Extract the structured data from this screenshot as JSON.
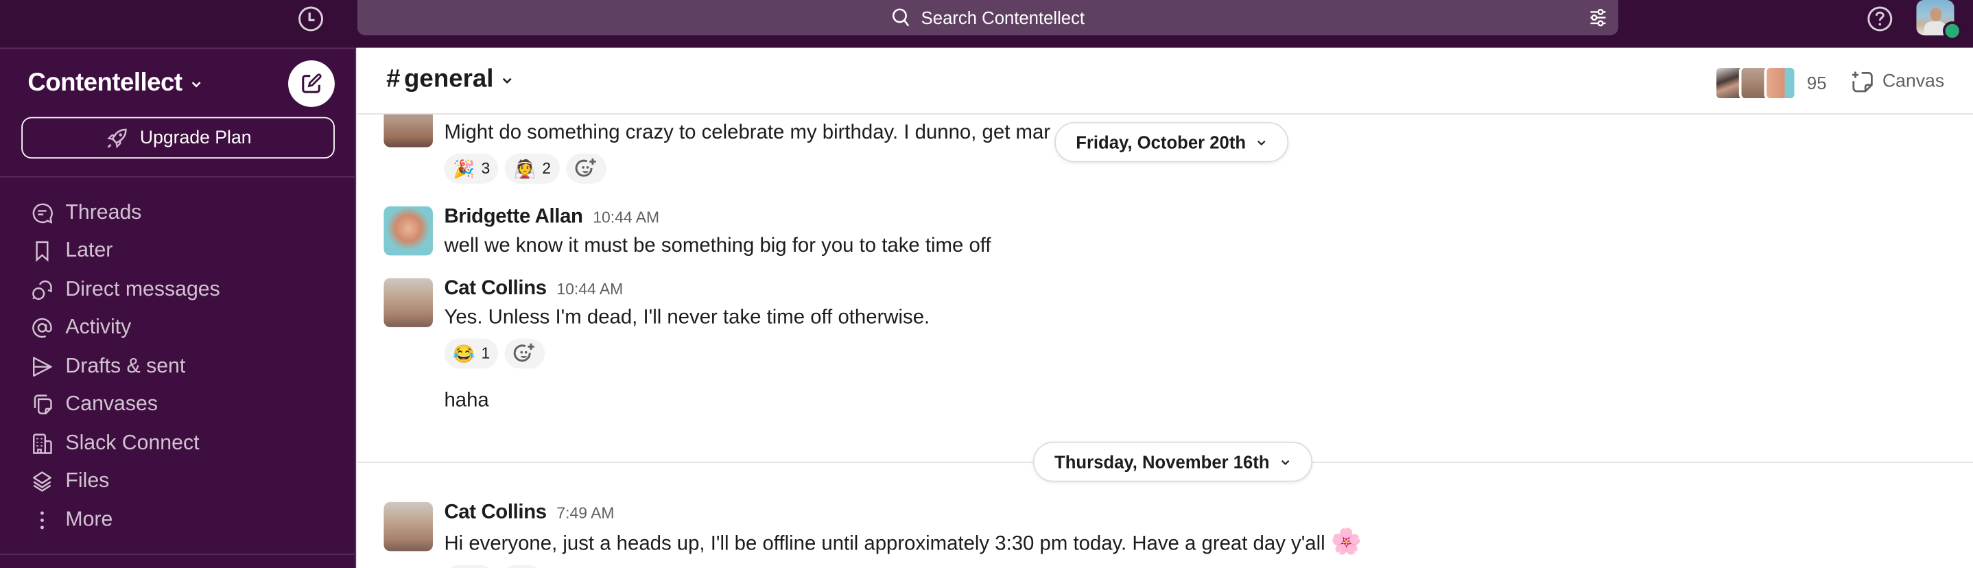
{
  "topbar": {
    "search_placeholder": "Search Contentellect",
    "icons": {
      "history": "clock-icon",
      "search": "search-icon",
      "filter": "sliders-icon",
      "help": "help-icon"
    },
    "user_presence": "active"
  },
  "sidebar": {
    "workspace_name": "Contentellect",
    "upgrade_label": "Upgrade Plan",
    "items": [
      {
        "label": "Threads",
        "icon": "threads-icon"
      },
      {
        "label": "Later",
        "icon": "bookmark-icon"
      },
      {
        "label": "Direct messages",
        "icon": "direct-messages-icon"
      },
      {
        "label": "Activity",
        "icon": "at-sign-icon"
      },
      {
        "label": "Drafts & sent",
        "icon": "send-icon"
      },
      {
        "label": "Canvases",
        "icon": "canvases-icon"
      },
      {
        "label": "Slack Connect",
        "icon": "building-icon"
      },
      {
        "label": "Files",
        "icon": "layers-icon"
      },
      {
        "label": "More",
        "icon": "more-vertical-icon"
      }
    ]
  },
  "channel": {
    "prefix": "#",
    "name": "general",
    "member_count": "95",
    "canvas_label": "Canvas"
  },
  "date_dividers": [
    {
      "label": "Friday, October 20th"
    },
    {
      "label": "Thursday, November 16th"
    }
  ],
  "messages": [
    {
      "author": "",
      "time": "",
      "text": "Might do something crazy to celebrate my birthday. I dunno, get mar",
      "reactions": [
        {
          "emoji": "🎉",
          "count": "3"
        },
        {
          "emoji": "👰",
          "count": "2"
        }
      ]
    },
    {
      "author": "Bridgette Allan",
      "time": "10:44 AM",
      "text": "well we know it must be something big for you to take time off",
      "reactions": []
    },
    {
      "author": "Cat Collins",
      "time": "10:44 AM",
      "text": "Yes. Unless I'm dead, I'll never take time off otherwise.",
      "reactions": [
        {
          "emoji": "😂",
          "count": "1"
        }
      ]
    },
    {
      "author": "",
      "time": "",
      "text": "haha",
      "reactions": []
    },
    {
      "author": "Cat Collins",
      "time": "7:49 AM",
      "text": "Hi everyone, just a heads up, I'll be offline until approximately 3:30 pm today. Have a great day y'all",
      "text_emoji": "🌸",
      "reactions": []
    }
  ],
  "colors": {
    "topbar_bg": "#350d36",
    "sidebar_bg": "#3f0e40",
    "search_bg": "#5f4062",
    "presence_green": "#2bac76",
    "text_primary": "#1d1c1d",
    "text_secondary": "#616061"
  }
}
